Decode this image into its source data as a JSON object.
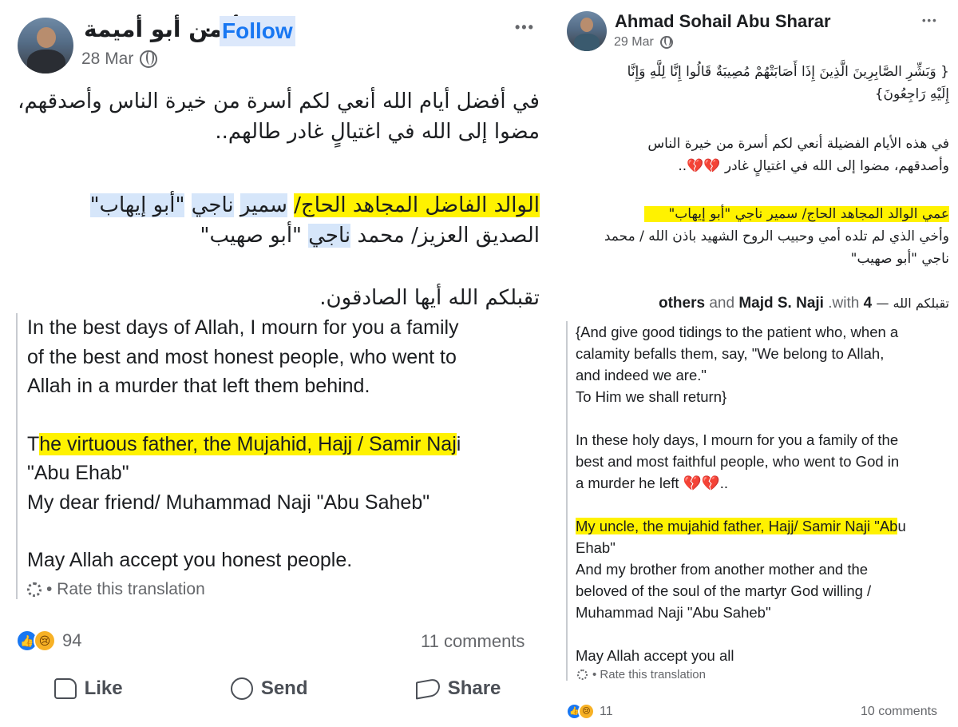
{
  "left_post": {
    "author": "أيمن أبو أميمة",
    "separator": "·",
    "follow_label": "Follow",
    "date": "28 Mar",
    "more": "•••",
    "arabic_lines": [
      "في أفضل أيام الله أنعي لكم أسرة من خيرة الناس وأصدقهم،",
      "مضوا إلى الله في اغتيالٍ غادر طالهم..",
      "",
      "",
      "",
      "تقبلكم الله أيها الصادقون."
    ],
    "arabic_highlight_line1": {
      "hl": "الوالد الفاضل المجاهد الحاج/",
      "a": "سمير",
      "b": "ناجي",
      "c": "\"أبو إيهاب\""
    },
    "arabic_highlight_line2": {
      "a": "الصديق العزيز/ محمد",
      "b": "ناجي",
      "c": "\"أبو صهيب\""
    },
    "translation": {
      "p1": [
        "In the best days of Allah, I mourn for you a family",
        "of the best and most honest people, who went to",
        "Allah in a murder that left them behind."
      ],
      "p2_pre": "T",
      "p2_hl": "he virtuous father, the Mujahid, Hajj / Samir Naj",
      "p2_post": "i",
      "p2_rest": [
        "\"Abu Ehab\"",
        "My dear friend/ Muhammad Naji \"Abu Saheb\""
      ],
      "p3": "May Allah accept you honest people."
    },
    "rate_label": "• Rate this translation",
    "reaction_count": "94",
    "comments_label": "11 comments",
    "actions": {
      "like": "Like",
      "send": "Send",
      "share": "Share"
    }
  },
  "right_post": {
    "author": "Ahmad Sohail Abu Sharar",
    "date": "29 Mar",
    "more": "•••",
    "arabic_quran": [
      "{ وَبَشِّرِ الصَّابِرِينَ الَّذِينَ إِذَا أَصَابَتْهُمْ مُصِيبَةٌ قَالُوا إِنَّا لِلَّهِ وَإِنَّا",
      "إِلَيْهِ رَاجِعُونَ}"
    ],
    "arabic_p2": [
      "في هذه الأيام الفضيلة أنعي لكم أسرة من خيرة الناس",
      "وأصدقهم، مضوا إلى الله في اغتيالٍ غادر 💔💔.."
    ],
    "arabic_hl": "عمي الوالد المجاهد الحاج/ سمير ناجي \"أبو إيهاب\"",
    "arabic_p3": [
      "وأخي الذي لم تلده أمي وحبيب الروح الشهيد باذن الله / محمد",
      "ناجي \"أبو صهيب\""
    ],
    "tag_prefix": "تقبلكم الله —",
    "tag_with": ".with",
    "tag_name": "Majd S. Naji",
    "tag_and": "and",
    "tag_others": "4 others",
    "translation": {
      "p1": [
        "{And give good tidings to the patient who, when a",
        "calamity befalls them, say, \"We belong to Allah,",
        "and indeed we are.\"",
        "To Him we shall return}"
      ],
      "p2": [
        "In these holy days, I mourn for you a family of the",
        "best and most faithful people, who went to God in",
        "a murder he left 💔💔.."
      ],
      "p3_hl": "My uncle, the mujahid father, Hajj/ Samir Naji \"Ab",
      "p3_post": "u",
      "p3_rest": [
        "Ehab\"",
        "And my brother from another mother and the",
        "beloved of the soul of the martyr God willing /",
        "Muhammad Naji \"Abu Saheb\""
      ],
      "p4": "May Allah accept you all"
    },
    "rate_label": "• Rate this translation",
    "reaction_count": "11",
    "comments_label": "10 comments"
  }
}
